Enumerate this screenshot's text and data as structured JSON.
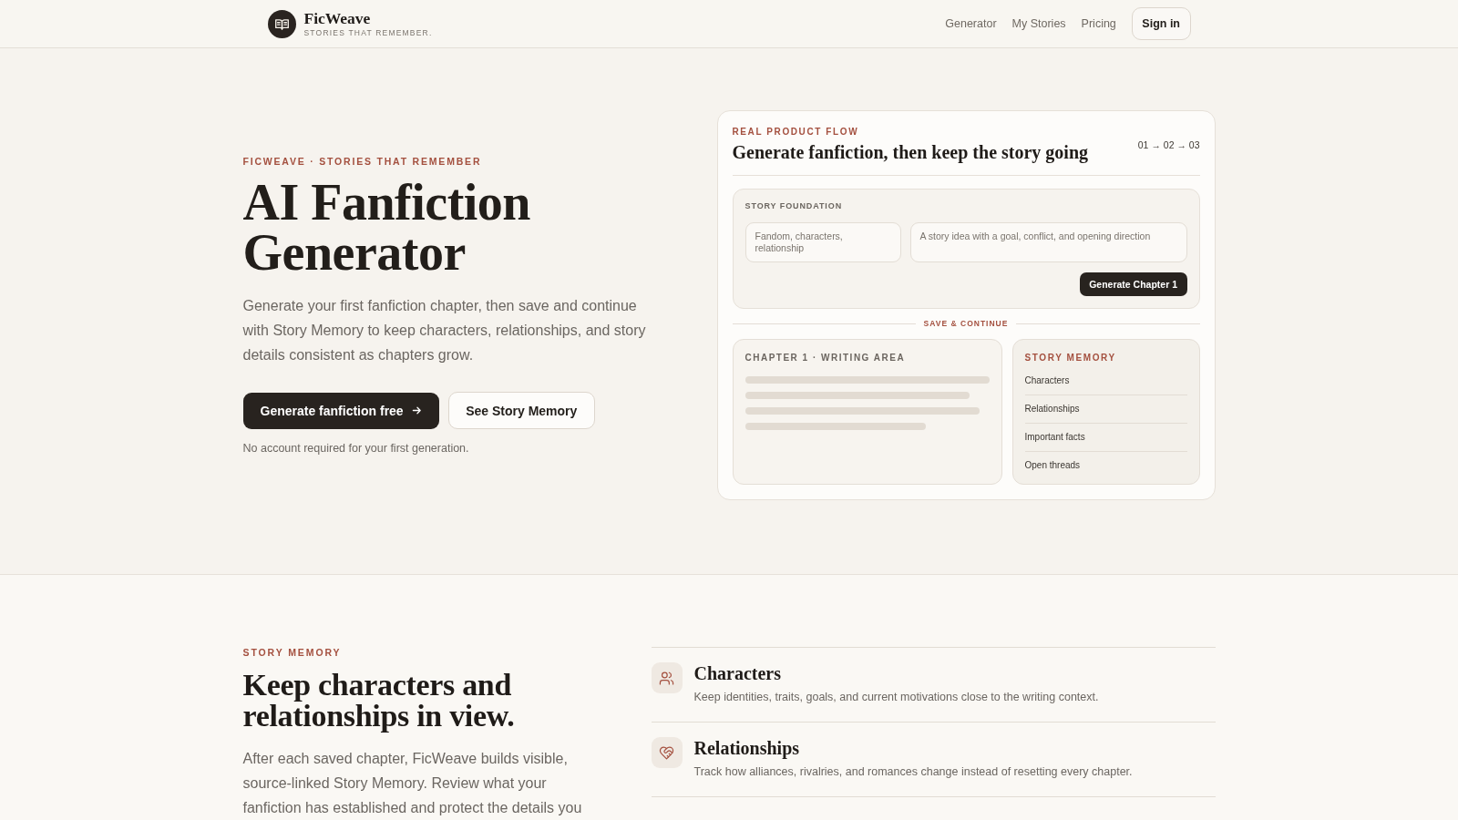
{
  "header": {
    "brand": "FicWeave",
    "tagline": "STORIES THAT REMEMBER.",
    "nav": [
      {
        "label": "Generator"
      },
      {
        "label": "My Stories"
      },
      {
        "label": "Pricing"
      }
    ],
    "sign_in": "Sign in"
  },
  "hero": {
    "eyebrow": "FICWEAVE · STORIES THAT REMEMBER",
    "title": "AI Fanfiction Generator",
    "lead": "Generate your first fanfiction chapter, then save and continue with Story Memory to keep characters, relationships, and story details consistent as chapters grow.",
    "primary_button": "Generate fanfiction free",
    "secondary_button": "See Story Memory",
    "note": "No account required for your first generation."
  },
  "product_card": {
    "eyebrow": "REAL PRODUCT FLOW",
    "title": "Generate fanfiction, then keep the story going",
    "steps": "01 → 02 → 03",
    "foundation": {
      "label": "STORY FOUNDATION",
      "fields": [
        {
          "placeholder": "Fandom, characters, relationship"
        },
        {
          "placeholder": "A story idea with a goal, conflict, and opening direction"
        }
      ],
      "button": "Generate Chapter 1"
    },
    "divider_label": "SAVE & CONTINUE",
    "writing_area": {
      "label": "CHAPTER 1 · WRITING AREA"
    },
    "memory": {
      "label": "STORY MEMORY",
      "items": [
        "Characters",
        "Relationships",
        "Important facts",
        "Open threads"
      ]
    }
  },
  "memory_section": {
    "eyebrow": "STORY MEMORY",
    "title": "Keep characters and relationships in view.",
    "body": "After each saved chapter, FicWeave builds visible, source-linked Story Memory. Review what your fanfiction has established and protect the details you",
    "features": [
      {
        "title": "Characters",
        "description": "Keep identities, traits, goals, and current motivations close to the writing context."
      },
      {
        "title": "Relationships",
        "description": "Track how alliances, rivalries, and romances change instead of resetting every chapter."
      }
    ]
  }
}
